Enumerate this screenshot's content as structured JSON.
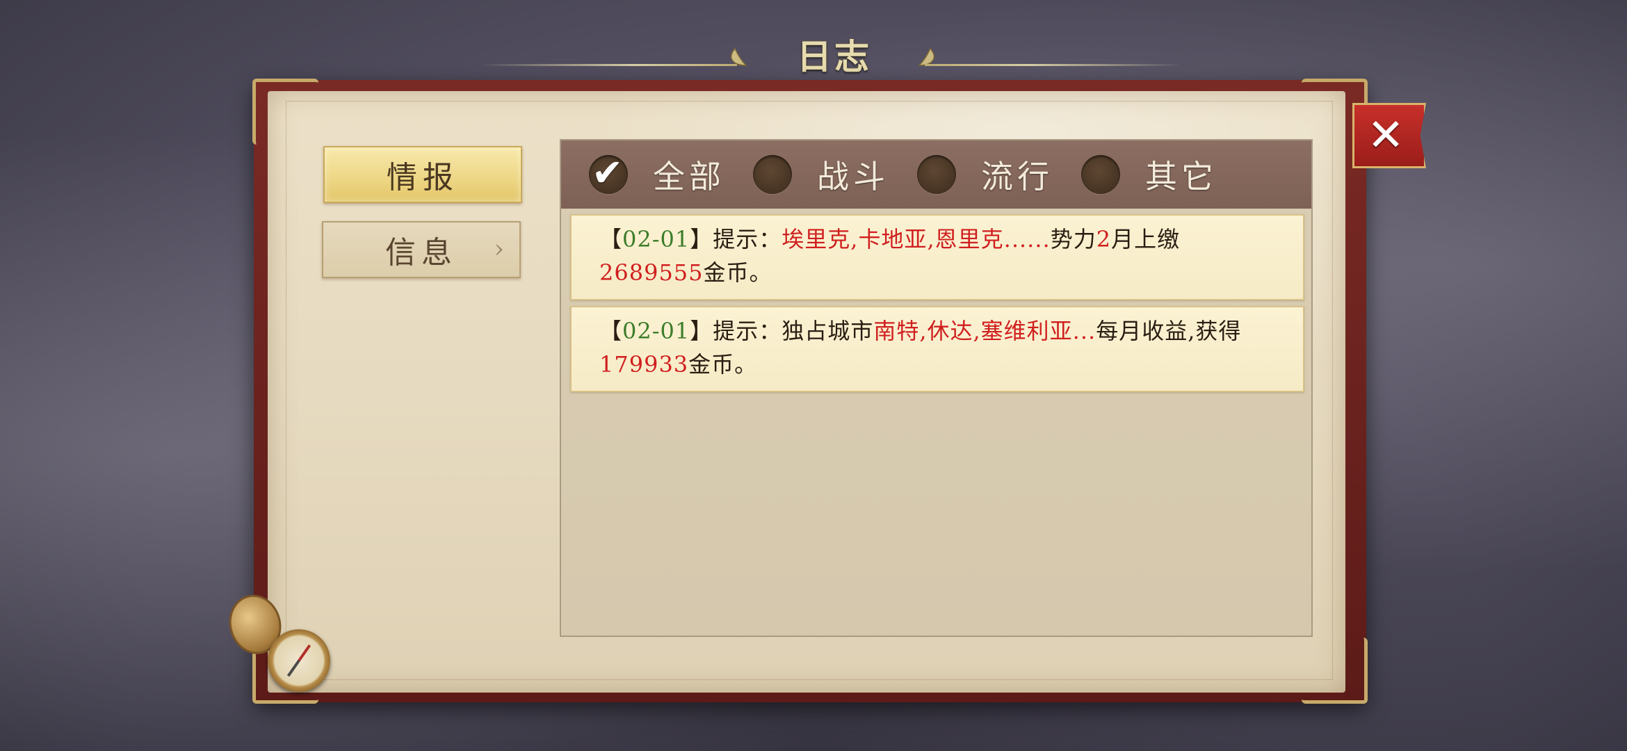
{
  "title": "日志",
  "sidebar": {
    "tabs": [
      {
        "label": "情报",
        "active": true
      },
      {
        "label": "信息",
        "active": false,
        "chevron": "›"
      }
    ]
  },
  "filters": [
    {
      "label": "全部",
      "checked": true
    },
    {
      "label": "战斗",
      "checked": false
    },
    {
      "label": "流行",
      "checked": false
    },
    {
      "label": "其它",
      "checked": false
    }
  ],
  "logs": [
    {
      "open": "【",
      "date": "02-01",
      "close": "】",
      "prefix": "提示：",
      "names": "埃里克,卡地亚,恩里克",
      "ellipsis": "......",
      "mid1": "势力",
      "month": "2",
      "mid2": "月上缴",
      "amount": "2689555",
      "suffix": "金币。"
    },
    {
      "open": "【",
      "date": "02-01",
      "close": "】",
      "prefix": "提示：",
      "mid1": "独占城市",
      "names": "南特,休达,塞维利亚...",
      "mid2": "每月收益,获得",
      "amount": "179933",
      "suffix": "金币。"
    }
  ],
  "close_button": {
    "icon": "close-icon",
    "glyph": "✕"
  },
  "colors": {
    "accent_red": "#d01f1f",
    "date_green": "#3c7d2a",
    "filter_bar": "#8c6e62",
    "active_tab": "#efd98a"
  }
}
